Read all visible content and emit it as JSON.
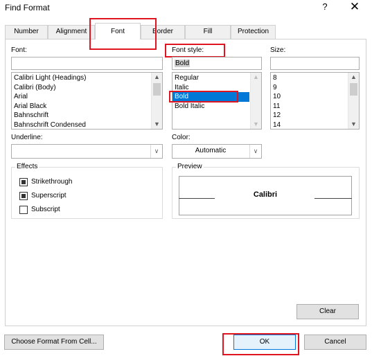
{
  "window": {
    "title": "Find Format",
    "help": "?",
    "close": "✕"
  },
  "tabs": [
    {
      "label": "Number"
    },
    {
      "label": "Alignment"
    },
    {
      "label": "Font"
    },
    {
      "label": "Border"
    },
    {
      "label": "Fill"
    },
    {
      "label": "Protection"
    }
  ],
  "font": {
    "label": "Font:",
    "value": "",
    "items": [
      "Calibri Light (Headings)",
      "Calibri (Body)",
      "Arial",
      "Arial Black",
      "Bahnschrift",
      "Bahnschrift Condensed"
    ]
  },
  "font_style": {
    "label": "Font style:",
    "value": "Bold",
    "items": [
      "Regular",
      "Italic",
      "Bold",
      "Bold Italic"
    ],
    "selected": "Bold"
  },
  "size": {
    "label": "Size:",
    "value": "",
    "items": [
      "8",
      "9",
      "10",
      "11",
      "12",
      "14"
    ]
  },
  "underline": {
    "label": "Underline:",
    "value": ""
  },
  "color": {
    "label": "Color:",
    "value": "Automatic"
  },
  "effects": {
    "title": "Effects",
    "strikethrough": "Strikethrough",
    "superscript": "Superscript",
    "subscript": "Subscript"
  },
  "preview": {
    "title": "Preview",
    "text": "Calibri"
  },
  "buttons": {
    "clear": "Clear",
    "choose_format": "Choose Format From Cell...",
    "ok": "OK",
    "cancel": "Cancel"
  },
  "colors": {
    "selection": "#0078d7",
    "annotation": "#e0141e"
  }
}
